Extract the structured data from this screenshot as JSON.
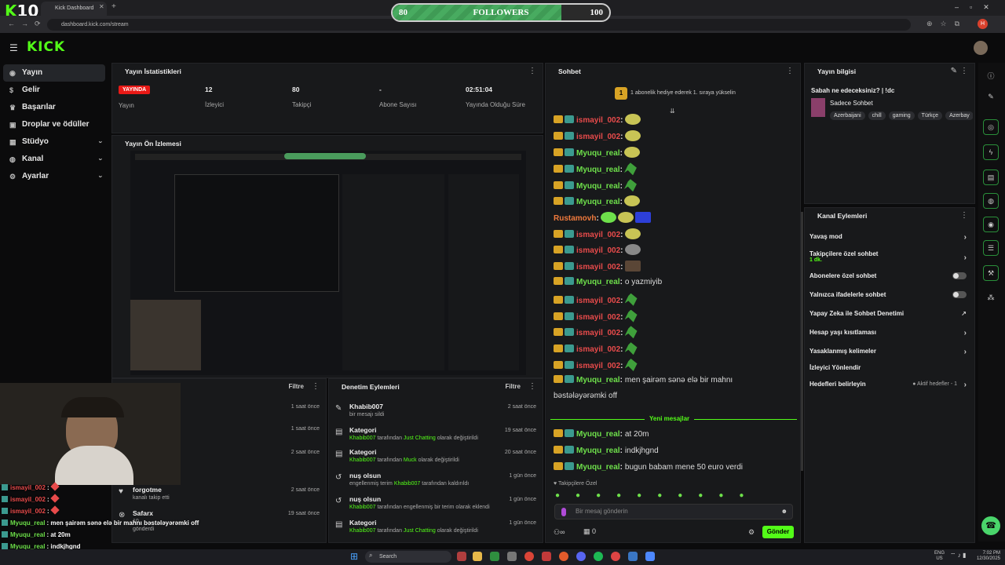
{
  "browser": {
    "tab_title": "Kick Dashboard",
    "url": "dashboard.kick.com/stream",
    "overlay_badge": "10",
    "overlay_badge_k": "K"
  },
  "followers_goal": {
    "start": "80",
    "label": "FOLLOWERS",
    "end": "100",
    "progress_fraction": 0.78
  },
  "logo": "KICK",
  "sidebar": {
    "items": [
      {
        "label": "Yayın",
        "icon": "radio-icon",
        "active": true
      },
      {
        "label": "Gelir",
        "icon": "dollar-icon"
      },
      {
        "label": "Başarılar",
        "icon": "trophy-icon"
      },
      {
        "label": "Droplar ve ödüller",
        "icon": "gift-icon"
      },
      {
        "label": "Stüdyo",
        "icon": "grid-icon",
        "chev": "›"
      },
      {
        "label": "Kanal",
        "icon": "user-icon",
        "chev": "›"
      },
      {
        "label": "Ayarlar",
        "icon": "gear-icon",
        "chev": "›"
      }
    ]
  },
  "stats": {
    "title": "Yayın İstatistikleri",
    "live_badge": "YAYINDA",
    "live_label": "Yayın",
    "items": [
      {
        "value": "12",
        "label": "İzleyici"
      },
      {
        "value": "80",
        "label": "Takipçi"
      },
      {
        "value": "-",
        "label": "Abone Sayısı"
      },
      {
        "value": "02:51:04",
        "label": "Yayında Olduğu Süre"
      }
    ]
  },
  "preview": {
    "title": "Yayın Ön İzlemesi"
  },
  "activity_left": {
    "filter": "Filtre",
    "items": [
      {
        "time": "1 saat önce"
      },
      {
        "time": "1 saat önce"
      },
      {
        "time": "2 saat önce"
      },
      {
        "title": "forgotme",
        "sub": "kanalı takip etti",
        "time": "2 saat önce"
      },
      {
        "title": "Safarx",
        "sub": "10",
        "sub2": "gönderdi",
        "time": "19 saat önce"
      }
    ]
  },
  "moderation": {
    "title": "Denetim Eylemleri",
    "filter": "Filtre",
    "items": [
      {
        "title": "Khabib007",
        "sub": "bir mesajı sildi",
        "time": "2 saat önce"
      },
      {
        "title": "Kategori",
        "user": "Khabib007",
        "mid": "tarafından",
        "hl": "Just Chatting",
        "rest": "olarak değiştirildi",
        "time": "19 saat önce"
      },
      {
        "title": "Kategori",
        "user": "Khabib007",
        "mid": "tarafından",
        "hl": "Muck",
        "rest": "olarak değiştirildi",
        "time": "20 saat önce"
      },
      {
        "title": "nuş olsun",
        "pre": "engellenmiş terim",
        "user": "Khabib007",
        "rest": "tarafından kaldırıldı",
        "time": "1 gün önce"
      },
      {
        "title": "nuş olsun",
        "user": "Khabib007",
        "rest": "tarafından engellenmiş bir terim olarak eklendi",
        "time": "1 gün önce"
      },
      {
        "title": "Kategori",
        "user": "Khabib007",
        "mid": "tarafından",
        "hl": "Just Chatting",
        "rest": "olarak değiştirildi",
        "time": "1 gün önce"
      }
    ]
  },
  "chat": {
    "title": "Sohbet",
    "pinned": "1 abonelik hediye ederek 1. sıraya yükselin",
    "pinned_num": "1",
    "messages": [
      {
        "user": "ismayil_002",
        "color": "red",
        "emote": "smile"
      },
      {
        "user": "ismayil_002",
        "color": "red",
        "emote": "smile"
      },
      {
        "user": "Myuqu_real",
        "color": "grn",
        "emote": "smile"
      },
      {
        "user": "Myuqu_real",
        "color": "grn",
        "emote": "green"
      },
      {
        "user": "Myuqu_real",
        "color": "grn",
        "emote": "green"
      },
      {
        "user": "Myuqu_real",
        "color": "grn",
        "emote": "smile"
      },
      {
        "user": "Rustamovh",
        "color": "org",
        "emote": "multi",
        "nobadge": true
      },
      {
        "user": "ismayil_002",
        "color": "red",
        "emote": "smile"
      },
      {
        "user": "ismayil_002",
        "color": "red",
        "emote": "dog"
      },
      {
        "user": "ismayil_002",
        "color": "red",
        "emote": "face"
      },
      {
        "user": "Myuqu_real",
        "color": "grn",
        "text": "o yazmiyib"
      },
      {
        "user": "ismayil_002",
        "color": "red",
        "emote": "green"
      },
      {
        "user": "ismayil_002",
        "color": "red",
        "emote": "green"
      },
      {
        "user": "ismayil_002",
        "color": "red",
        "emote": "green"
      },
      {
        "user": "ismayil_002",
        "color": "red",
        "emote": "green"
      },
      {
        "user": "ismayil_002",
        "color": "red",
        "emote": "green"
      },
      {
        "user": "Myuqu_real",
        "color": "grn",
        "text": "men şairəm sənə elə bir mahnı"
      },
      {
        "cont": "bəstələyərəmki off"
      }
    ],
    "new_label": "Yeni mesajlar",
    "new_messages": [
      {
        "user": "Myuqu_real",
        "text": "at 20m"
      },
      {
        "user": "Myuqu_real",
        "text": "indkjhgnd"
      },
      {
        "user": "Myuqu_real",
        "text": "bugun babam mene 50 euro verdi"
      }
    ],
    "followers_only": "Takipçilere Özel",
    "input_placeholder": "Bir mesaj gönderin",
    "count": "0",
    "send": "Gönder"
  },
  "info": {
    "title": "Yayın bilgisi",
    "stream_title": "Sabah ne edeceksiniz? | !dc",
    "category": "Sadece Sohbet",
    "tags": [
      "Azerbaijani",
      "chill",
      "gaming",
      "Türkçe",
      "Azerbay"
    ]
  },
  "channel_actions": {
    "title": "Kanal Eylemleri",
    "items": [
      {
        "label": "Yavaş mod",
        "type": "chev"
      },
      {
        "label": "Takipçilere özel sohbet",
        "sub": "1 dk.",
        "type": "chev"
      },
      {
        "label": "Abonelere özel sohbet",
        "type": "toggle"
      },
      {
        "label": "Yalnızca ifadelerle sohbet",
        "type": "toggle"
      },
      {
        "label": "Yapay Zeka ile Sohbet Denetimi",
        "type": "ext"
      },
      {
        "label": "Hesap yaşı kısıtlaması",
        "type": "chev"
      },
      {
        "label": "Yasaklanmış kelimeler",
        "type": "chev"
      },
      {
        "label": "İzleyici Yönlendir",
        "type": "none"
      },
      {
        "label": "Hedefleri belirleyin",
        "type": "chev",
        "right": "Aktif hedefler - 1"
      }
    ]
  },
  "overlay_chat": [
    {
      "user": "ismayil_002",
      "text": ":",
      "color": "red"
    },
    {
      "user": "ismayil_002",
      "text": ":",
      "color": "red"
    },
    {
      "user": "ismayil_002",
      "text": ":",
      "color": "red"
    },
    {
      "user": "Myuqu_real",
      "text": ": men şairəm sənə elə bir mahnı bəstələyərəmki off",
      "color": "grn"
    },
    {
      "user": "Myuqu_real",
      "text": ": at 20m",
      "color": "grn"
    },
    {
      "user": "Myuqu_real",
      "text": ": indkjhgnd",
      "color": "grn"
    },
    {
      "user": "Myuqu_real",
      "text": ": bugun babam mene 50 euro verdi",
      "color": "grn"
    }
  ],
  "taskbar": {
    "search": "Search",
    "lang": "ENG",
    "region": "US",
    "time": "7:02 PM",
    "date": "12/30/2025"
  },
  "colors": {
    "accent": "#53fc18",
    "live": "#e91916"
  }
}
